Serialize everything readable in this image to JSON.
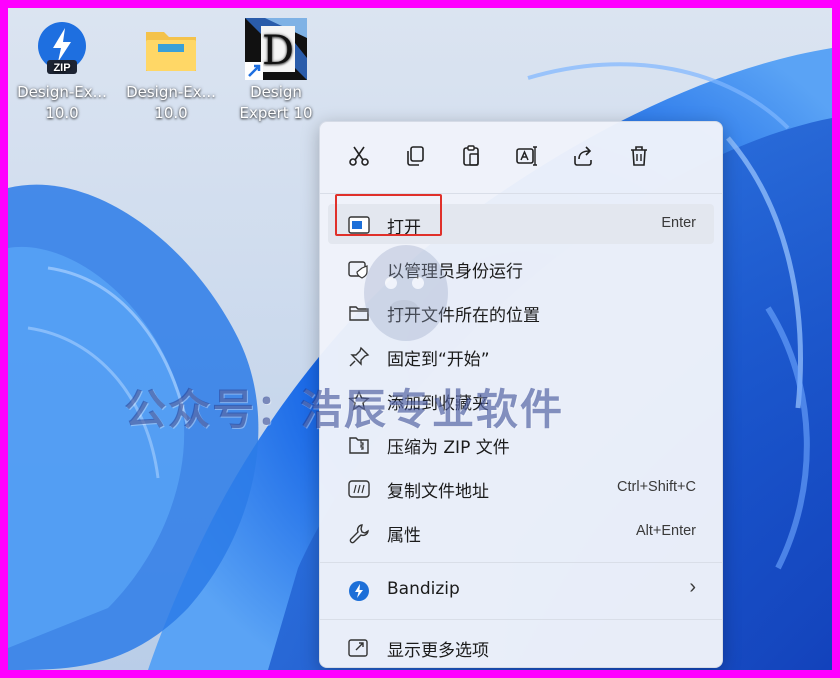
{
  "desktop": {
    "icons": [
      {
        "label": "Design-Ex... 10.0",
        "line1": "Design-Ex...",
        "line2": "10.0",
        "icon": "zip-archive-icon",
        "badge": "ZIP"
      },
      {
        "label": "Design-Ex... 10.0",
        "line1": "Design-Ex...",
        "line2": "10.0",
        "icon": "folder-icon"
      },
      {
        "label": "Design Expert 10",
        "line1": "Design",
        "line2": "Expert 10",
        "icon": "design-expert-app-icon",
        "glyph": "D"
      }
    ]
  },
  "context_menu": {
    "toolbar": [
      {
        "name": "cut",
        "icon": "scissors-icon"
      },
      {
        "name": "copy",
        "icon": "copy-icon"
      },
      {
        "name": "paste",
        "icon": "paste-icon"
      },
      {
        "name": "rename",
        "icon": "rename-icon"
      },
      {
        "name": "share",
        "icon": "share-icon"
      },
      {
        "name": "delete",
        "icon": "trash-icon"
      }
    ],
    "items": [
      {
        "label": "打开",
        "shortcut": "Enter",
        "icon": "open-icon"
      },
      {
        "label": "以管理员身份运行",
        "shortcut": "",
        "icon": "run-as-admin-icon"
      },
      {
        "label": "打开文件所在的位置",
        "shortcut": "",
        "icon": "folder-outline-icon"
      },
      {
        "label": "固定到“开始”",
        "shortcut": "",
        "icon": "pin-icon"
      },
      {
        "label": "添加到收藏夹",
        "shortcut": "",
        "icon": "star-icon"
      },
      {
        "label": "压缩为 ZIP 文件",
        "shortcut": "",
        "icon": "zip-folder-icon"
      },
      {
        "label": "复制文件地址",
        "shortcut": "Ctrl+Shift+C",
        "icon": "path-icon"
      },
      {
        "label": "属性",
        "shortcut": "Alt+Enter",
        "icon": "wrench-icon"
      }
    ],
    "bandizip": {
      "label": "Bandizip",
      "icon": "bandizip-icon",
      "submenu": "›"
    },
    "more": {
      "label": "显示更多选项",
      "icon": "more-options-icon"
    }
  },
  "watermark": {
    "text": "公众号：浩辰专业软件"
  },
  "colors": {
    "highlight": "#e0302a",
    "accent": "#1d6fd8",
    "watermark": "#283c8c"
  }
}
